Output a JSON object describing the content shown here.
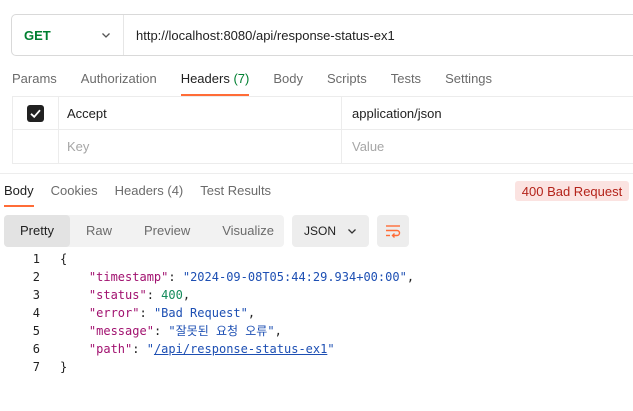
{
  "request": {
    "method": "GET",
    "url": "http://localhost:8080/api/response-status-ex1"
  },
  "request_tabs": [
    {
      "label": "Params",
      "count": ""
    },
    {
      "label": "Authorization",
      "count": ""
    },
    {
      "label": "Headers",
      "count": "(7)"
    },
    {
      "label": "Body",
      "count": ""
    },
    {
      "label": "Scripts",
      "count": ""
    },
    {
      "label": "Tests",
      "count": ""
    },
    {
      "label": "Settings",
      "count": ""
    }
  ],
  "headers_table": {
    "rows": [
      {
        "key": "Accept",
        "value": "application/json",
        "checked": true
      }
    ],
    "key_placeholder": "Key",
    "value_placeholder": "Value"
  },
  "response_tabs": [
    {
      "label": "Body"
    },
    {
      "label": "Cookies"
    },
    {
      "label": "Headers (4)"
    },
    {
      "label": "Test Results"
    }
  ],
  "status_badge": "400 Bad Request",
  "view_modes": [
    "Pretty",
    "Raw",
    "Preview",
    "Visualize"
  ],
  "format": "JSON",
  "code": {
    "line_numbers": [
      "1",
      "2",
      "3",
      "4",
      "5",
      "6",
      "7"
    ],
    "open_brace": "{",
    "close_brace": "}",
    "fields": [
      {
        "key": "\"timestamp\"",
        "value": "\"2024-09-08T05:44:29.934+00:00\"",
        "type": "string",
        "comma": ","
      },
      {
        "key": "\"status\"",
        "value": "400",
        "type": "number",
        "comma": ","
      },
      {
        "key": "\"error\"",
        "value": "\"Bad Request\"",
        "type": "string",
        "comma": ","
      },
      {
        "key": "\"message\"",
        "value": "\"잘못된 요청 오류\"",
        "type": "string",
        "comma": ","
      },
      {
        "key": "\"path\"",
        "value_open_quote": "\"",
        "value_link": "/api/response-status-ex1",
        "value_close_quote": "\"",
        "type": "link",
        "comma": ""
      }
    ]
  },
  "colors": {
    "method_get": "#007f31",
    "active_tab_underline": "#ff6c37",
    "status_error_bg": "#fbe3e1",
    "status_error_text": "#b4231a",
    "json_key": "#a1116f",
    "json_string": "#1d4fb3",
    "json_number": "#138a5a"
  },
  "icons": {
    "method_dropdown": "chevron-down-icon",
    "format_dropdown": "chevron-down-icon",
    "wrap": "wrap-lines-icon",
    "header_checkbox": "checkmark-icon"
  }
}
